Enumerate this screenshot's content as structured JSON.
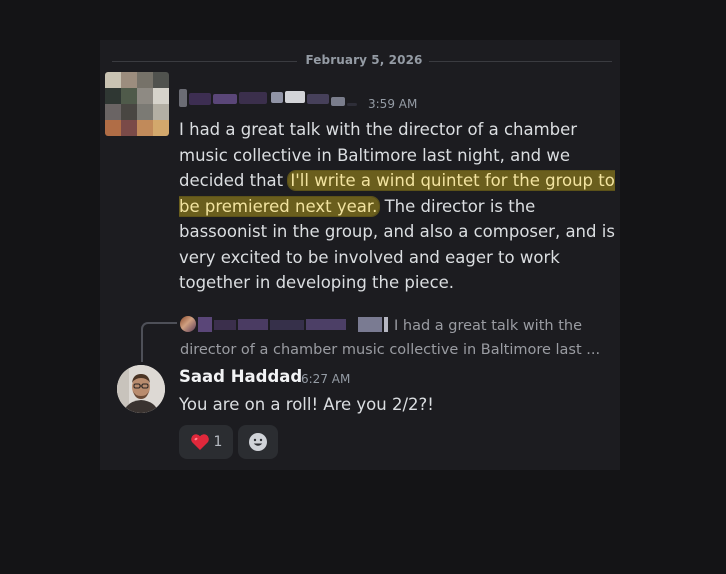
{
  "divider": {
    "date": "February 5, 2026"
  },
  "message1": {
    "timestamp": "3:59 AM",
    "text_before": "I had a great talk with the director of a chamber music collective in Baltimore last night, and we decided that ",
    "text_highlight": "I'll write a wind quintet for the group to be premiered next year.",
    "text_after": " The director is the bassoonist in the group, and also a composer, and is very excited to be involved and eager to work together in developing the piece."
  },
  "reply_ref": {
    "preview_line1": "I had a great talk with the",
    "preview_line2": "director of a chamber music collective in Baltimore last ..."
  },
  "message2": {
    "author": "Saad Haddad",
    "timestamp": "6:27 AM",
    "text": "You are on a roll! Are you 2/2?!"
  },
  "reactions": [
    {
      "emoji": "heart",
      "count": "1"
    }
  ],
  "colors": {
    "background": "#141416",
    "highlight": "#6a5e1d",
    "text": "#dbdee1",
    "muted": "#949ba4"
  },
  "icons": [
    "heart-emoji-icon",
    "add-reaction-icon",
    "smiley-icon"
  ]
}
